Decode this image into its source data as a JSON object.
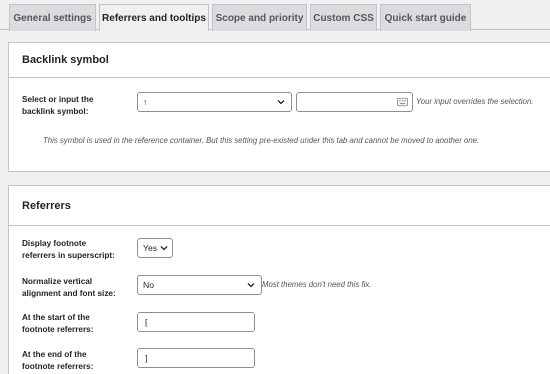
{
  "tabs": [
    {
      "label": "General settings"
    },
    {
      "label": "Referrers and tooltips"
    },
    {
      "label": "Scope and priority"
    },
    {
      "label": "Custom CSS"
    },
    {
      "label": "Quick start guide"
    }
  ],
  "backlink": {
    "heading": "Backlink symbol",
    "label_line1": "Select or input the",
    "label_line2": "backlink symbol:",
    "select_value": "↑",
    "input_value": "",
    "input_hint": "Your input overrides the selection.",
    "note": "This symbol is used in the reference container. But this setting pre-existed under this tab and cannot be moved to another one."
  },
  "referrers": {
    "heading": "Referrers",
    "superscript": {
      "label_line1": "Display footnote",
      "label_line2": "referrers in superscript:",
      "value": "Yes"
    },
    "normalize": {
      "label_line1": "Normalize vertical",
      "label_line2": "alignment and font size:",
      "value": "No",
      "hint": "Most themes don't need this fix."
    },
    "start": {
      "label_line1": "At the start of the",
      "label_line2": "footnote referrers:",
      "value": "["
    },
    "end": {
      "label_line1": "At the end of the",
      "label_line2": "footnote referrers:",
      "value": "]"
    }
  }
}
